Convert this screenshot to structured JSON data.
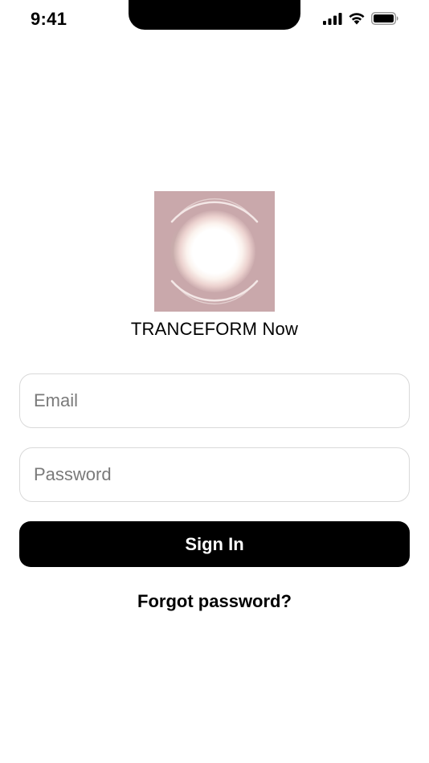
{
  "status_bar": {
    "time": "9:41",
    "icons": [
      "cellular-signal-icon",
      "wifi-icon",
      "battery-icon"
    ]
  },
  "logo": {
    "icon": "glowing-orb-logo-icon",
    "background_color": "#c9a8ab"
  },
  "app": {
    "title": "TRANCEFORM Now"
  },
  "form": {
    "email": {
      "placeholder": "Email",
      "value": ""
    },
    "password": {
      "placeholder": "Password",
      "value": ""
    },
    "sign_in_label": "Sign In",
    "forgot_password_label": "Forgot password?"
  },
  "colors": {
    "primary_button": "#000000",
    "primary_button_text": "#ffffff",
    "field_border": "#d9d9d9",
    "placeholder": "#7a7a7a"
  }
}
